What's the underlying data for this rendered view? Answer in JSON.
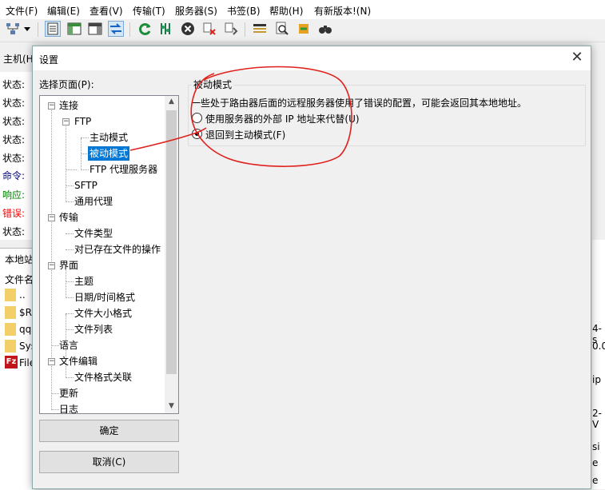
{
  "menu": [
    "文件(F)",
    "编辑(E)",
    "查看(V)",
    "传输(T)",
    "服务器(S)",
    "书签(B)",
    "帮助(H)",
    "有新版本!(N)"
  ],
  "toolbar_icons": [
    "site-manager-icon",
    "dropdown-arrow-icon",
    "toggle-log-icon",
    "toggle-local-tree-icon",
    "toggle-remote-tree-icon",
    "toggle-queue-icon",
    "refresh-icon",
    "process-queue-icon",
    "cancel-icon",
    "disconnect-icon",
    "reconnect-icon",
    "directory-listing-filter-icon",
    "search-icon",
    "sync-browse-icon",
    "binoculars-icon"
  ],
  "host_label": "主机(H",
  "log": [
    {
      "label": "状态:",
      "color": "#000000"
    },
    {
      "label": "状态:",
      "color": "#000000"
    },
    {
      "label": "状态:",
      "color": "#000000"
    },
    {
      "label": "状态:",
      "color": "#000000"
    },
    {
      "label": "状态:",
      "color": "#000000"
    },
    {
      "label": "命令:",
      "color": "#000080"
    },
    {
      "label": "响应:",
      "color": "#008000"
    },
    {
      "label": "错误:",
      "color": "#ff0000"
    },
    {
      "label": "状态:",
      "color": "#000000"
    }
  ],
  "local": {
    "header": "本地站",
    "column": "文件名",
    "files": [
      "..",
      "$R",
      "qq",
      "Sys",
      "File"
    ]
  },
  "right_fragments": [
    "4-s",
    "0.0.",
    "ip",
    "2-V",
    "si",
    "e",
    "e"
  ],
  "dialog": {
    "title": "设置",
    "close": "✕",
    "select_page_label": "选择页面(P):",
    "tree": {
      "connection": "连接",
      "ftp": "FTP",
      "active_mode": "主动模式",
      "passive_mode": "被动模式",
      "ftp_proxy": "FTP 代理服务器",
      "sftp": "SFTP",
      "generic_proxy": "通用代理",
      "transfers": "传输",
      "file_types": "文件类型",
      "file_exists_action": "对已存在文件的操作",
      "interface": "界面",
      "themes": "主题",
      "date_time_format": "日期/时间格式",
      "filesize_format": "文件大小格式",
      "file_lists": "文件列表",
      "language": "语言",
      "file_editing": "文件编辑",
      "filetype_associations": "文件格式关联",
      "updates": "更新",
      "logging": "日志"
    },
    "ok": "确定",
    "cancel": "取消(C)",
    "passive": {
      "group_title": "被动模式",
      "description": "一些处于路由器后面的远程服务器使用了错误的配置，可能会返回其本地地址。",
      "option_external_ip": "使用服务器的外部 IP 地址来代替(U)",
      "option_fallback_active": "退回到主动模式(F)",
      "selected": "fallback_active"
    }
  },
  "annotation_color": "#e0201c"
}
